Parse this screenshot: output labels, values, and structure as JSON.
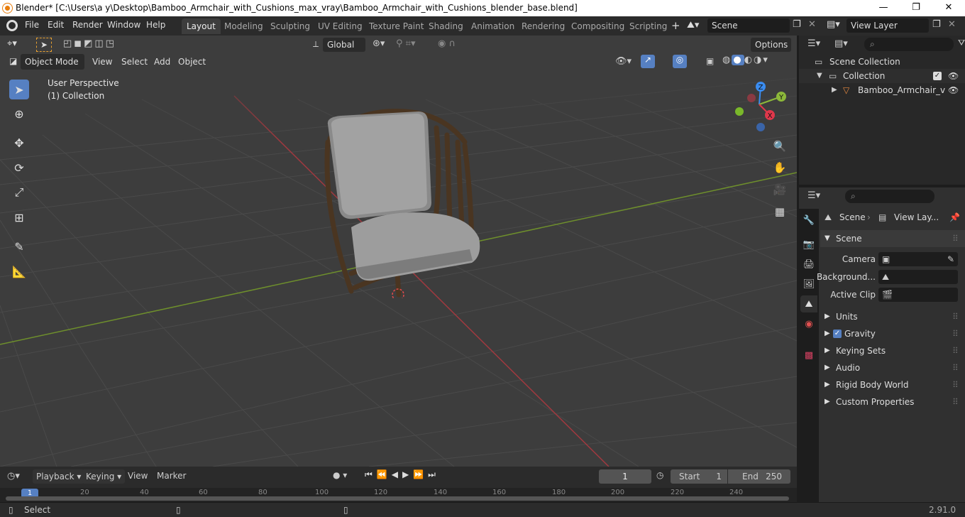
{
  "window": {
    "title": "Blender* [C:\\Users\\a y\\Desktop\\Bamboo_Armchair_with_Cushions_max_vray\\Bamboo_Armchair_with_Cushions_blender_base.blend]",
    "minimize": "—",
    "maximize": "❐",
    "close": "✕"
  },
  "menu": [
    "File",
    "Edit",
    "Render",
    "Window",
    "Help"
  ],
  "workspaces": [
    "Layout",
    "Modeling",
    "Sculpting",
    "UV Editing",
    "Texture Paint",
    "Shading",
    "Animation",
    "Rendering",
    "Compositing",
    "Scripting"
  ],
  "add_workspace": "+",
  "scene": {
    "name": "Scene"
  },
  "view_layer": {
    "name": "View Layer"
  },
  "toolbar": {
    "transform_orientation": "Global",
    "options": "Options"
  },
  "viewport": {
    "mode": "Object Mode",
    "menus": [
      "View",
      "Select",
      "Add",
      "Object"
    ],
    "overlay_title": "User Perspective",
    "overlay_subtitle": "(1) Collection",
    "gizmo": {
      "z": "Z",
      "y": "Y",
      "x": "X"
    }
  },
  "outliner": {
    "root": "Scene Collection",
    "collection": "Collection",
    "object": "Bamboo_Armchair_v"
  },
  "properties": {
    "breadcrumb_scene": "Scene",
    "breadcrumb_view_layer": "View Lay...",
    "panel_title": "Scene",
    "camera_label": "Camera",
    "background_label": "Background...",
    "active_clip_label": "Active Clip",
    "subpanels": [
      "Units",
      "Gravity",
      "Keying Sets",
      "Audio",
      "Rigid Body World",
      "Custom Properties"
    ],
    "gravity_checked": true
  },
  "timeline": {
    "menus": [
      "Playback",
      "Keying",
      "View",
      "Marker"
    ],
    "current_frame": "1",
    "start_label": "Start",
    "start_value": "1",
    "end_label": "End",
    "end_value": "250",
    "ruler_ticks": [
      "1",
      "20",
      "40",
      "60",
      "80",
      "100",
      "120",
      "140",
      "160",
      "180",
      "200",
      "220",
      "240"
    ]
  },
  "statusbar": {
    "action": "Select",
    "version": "2.91.0"
  },
  "colors": {
    "accent": "#5680c2",
    "x_axis": "#e0374b",
    "y_axis": "#8cb83a",
    "z_axis": "#3a8cf0",
    "grid_bg": "#3d3d3d"
  }
}
